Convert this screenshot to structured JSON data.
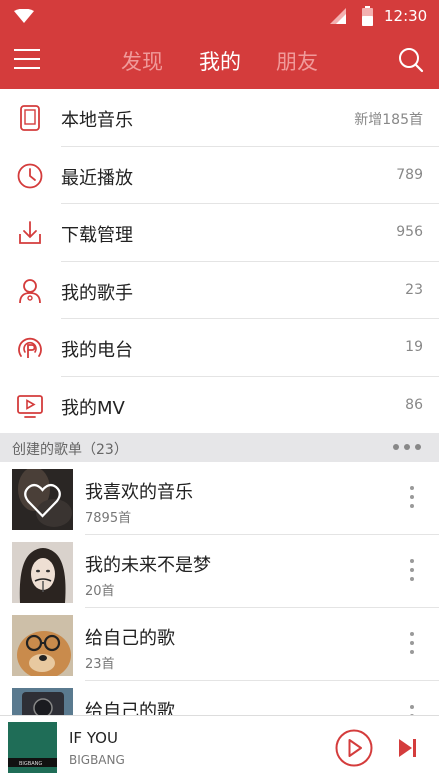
{
  "status_bar": {
    "time": "12:30"
  },
  "nav": {
    "tabs": [
      {
        "label": "发现"
      },
      {
        "label": "我的"
      },
      {
        "label": "朋友"
      }
    ]
  },
  "menu": {
    "items": [
      {
        "label": "本地音乐",
        "count": "新增185首",
        "icon": "phone-icon"
      },
      {
        "label": "最近播放",
        "count": "789",
        "icon": "clock-icon"
      },
      {
        "label": "下载管理",
        "count": "956",
        "icon": "download-icon"
      },
      {
        "label": "我的歌手",
        "count": "23",
        "icon": "singer-icon"
      },
      {
        "label": "我的电台",
        "count": "19",
        "icon": "radio-icon"
      },
      {
        "label": "我的MV",
        "count": "86",
        "icon": "mv-icon"
      }
    ]
  },
  "section": {
    "title": "创建的歌单（23）"
  },
  "playlists": [
    {
      "name": "我喜欢的音乐",
      "sub": "7895首"
    },
    {
      "name": "我的未来不是梦",
      "sub": "20首"
    },
    {
      "name": "给自己的歌",
      "sub": "23首"
    },
    {
      "name": "给自己的歌",
      "sub": ""
    }
  ],
  "player": {
    "song": "IF YOU",
    "artist": "BIGBANG"
  },
  "colors": {
    "accent": "#d43c3c",
    "tab_inactive": "#f09a9a"
  }
}
